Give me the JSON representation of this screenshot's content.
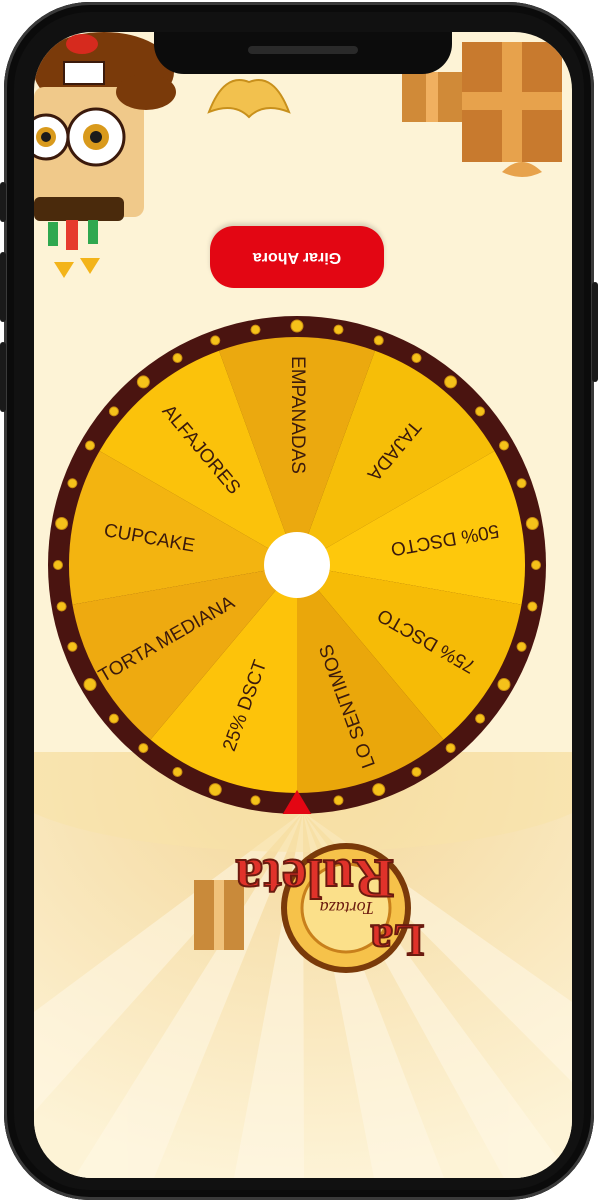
{
  "spin_button": {
    "label": "Girar Ahora"
  },
  "wheel": {
    "segments": [
      {
        "label": "EMPANADAS",
        "color": "#eba90f"
      },
      {
        "label": "TAJADA",
        "color": "#f6be08"
      },
      {
        "label": "50% DSCTO",
        "color": "#fec80c"
      },
      {
        "label": "75% DSCTO",
        "color": "#f6bb06"
      },
      {
        "label": "LO SENTIMOS",
        "color": "#eaa70b"
      },
      {
        "label": "25% DSCT",
        "color": "#fdc30a"
      },
      {
        "label": "TORTA MEDIANA",
        "color": "#eeaa10"
      },
      {
        "label": "CUPCAKE",
        "color": "#f3b410"
      },
      {
        "label": "ALFAJORES",
        "color": "#fbc20b"
      }
    ],
    "rim_color": "#4a1410",
    "pointer_color": "#e30613"
  },
  "logo": {
    "line1": "La",
    "line2": "Ruleta",
    "brand": "Tortaza"
  },
  "colors": {
    "background": "#fdf3d6",
    "accent": "#e30613"
  }
}
